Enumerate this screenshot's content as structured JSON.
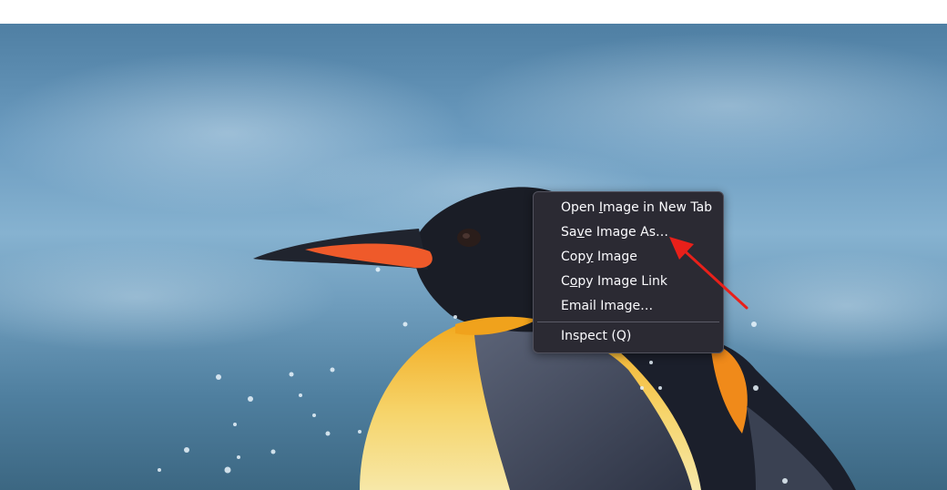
{
  "context_menu": {
    "items": [
      {
        "pre": "Open ",
        "key": "I",
        "post": "mage in New Tab"
      },
      {
        "pre": "Sa",
        "key": "v",
        "post": "e Image As…"
      },
      {
        "pre": "Cop",
        "key": "y",
        "post": " Image"
      },
      {
        "pre": "C",
        "key": "o",
        "post": "py Image Link"
      },
      {
        "pre": "Email Image…",
        "key": "",
        "post": ""
      },
      {
        "pre": "Inspect (Q)",
        "key": "",
        "post": ""
      }
    ]
  },
  "colors": {
    "menu_background": "#2b2a33",
    "menu_text": "#fbfbfe",
    "arrow": "#e8201a"
  },
  "icons": {
    "annotation": "red-arrow-icon"
  }
}
